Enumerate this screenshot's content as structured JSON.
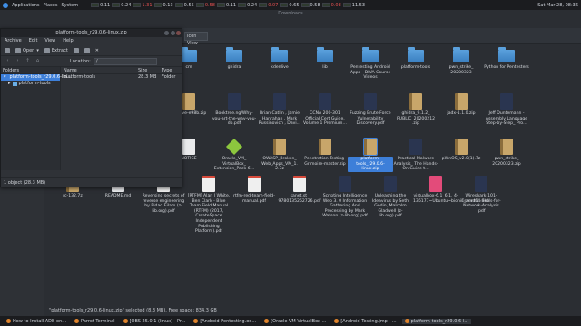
{
  "topbar": {
    "menus": [
      "Applications",
      "Places",
      "System"
    ],
    "clock": "Sat Mar 28, 08:36",
    "cells": [
      "0.11",
      "0.24",
      "1.31",
      "0.13",
      "0.55",
      "0.58",
      "0.11",
      "0.24",
      "0.07",
      "0.65",
      "0.58",
      "0.08",
      "11.53"
    ]
  },
  "file_manager": {
    "title": "Downloads",
    "view_select": "Icon View",
    "status": "\"platform-tools_r29.0.6-linux.zip\" selected (8.3 MB), Free space: 834.3 GB",
    "items": [
      {
        "label": "cm",
        "kind": "folder"
      },
      {
        "label": "ghidra",
        "kind": "folder"
      },
      {
        "label": "kdenlive",
        "kind": "folder"
      },
      {
        "label": "lib",
        "kind": "folder"
      },
      {
        "label": "Pentesting Android Apps - DIVA Course Videos",
        "kind": "folder"
      },
      {
        "label": "platform-tools",
        "kind": "folder"
      },
      {
        "label": "pwn_strike_ 20200323",
        "kind": "folder"
      },
      {
        "label": "Python for Pentesters",
        "kind": "folder"
      },
      {
        "label": "Archive-e98b.zip",
        "kind": "zip"
      },
      {
        "label": "Booktree.ng/Why-you-art-the-way-you-do.pdf",
        "kind": "cover"
      },
      {
        "label": "Brian Catlin , Jamie Hanrahan , Mark Russinovich , Davi…",
        "kind": "cover"
      },
      {
        "label": "CCNA 200-301 Official Cert Guide, Volume 1 Premium…",
        "kind": "cover"
      },
      {
        "label": "Fuzzing Brute Force Vulnerability Discovery.pdf",
        "kind": "cover"
      },
      {
        "label": "ghidra_9.1.2_ PUBLIC_20200212 .zip",
        "kind": "zip"
      },
      {
        "label": "jadx-1.1.0.zip",
        "kind": "zip"
      },
      {
        "label": "Jeff Duntemann - Assembly Language Step-by-Step_ Pro…",
        "kind": "cover"
      },
      {
        "label": "NOTICE",
        "kind": "doc"
      },
      {
        "label": "Oracle_VM_ VirtualBox_ Extension_Pack-6…",
        "kind": "box"
      },
      {
        "label": "OWASP_Broken_ Web_Apps_VM_1. 2.7z",
        "kind": "zip"
      },
      {
        "label": "Penetration-Testing-Grimoire-master.zip",
        "kind": "zip"
      },
      {
        "label": "platform-tools_r29.0.6-linux.zip",
        "kind": "zip",
        "selected": true
      },
      {
        "label": "Practical Malware Analysis_ The Hands-On Guide t…",
        "kind": "cover"
      },
      {
        "label": "pWnOS_v2.0(1).7z",
        "kind": "zip"
      },
      {
        "label": "pwn_strike_ 20200323.zip",
        "kind": "zip"
      },
      {
        "label": "rc-132.7z",
        "kind": "zip"
      },
      {
        "label": "README.md",
        "kind": "doc"
      },
      {
        "label": "Reversing secrets of reverse engineering by Eldad Eilam (z-lib.org).pdf",
        "kind": "pdf"
      },
      {
        "label": "[RTFM] Alan J White, Ben Clark - Blue Team Field Manual (RTFM) (2017, CreateSpace Independent Publishing Platform).pdf",
        "kind": "pdf"
      },
      {
        "label": "rtfm-red-team-field-manual.pdf",
        "kind": "pdf"
      },
      {
        "label": "sanet.st_ 9780135262726.pdf",
        "kind": "pdf"
      },
      {
        "label": "Scripting Intelligence Web 3. 0 Information Gathering And Processing by Mark Watson (z-lib.org).pdf",
        "kind": "cover"
      },
      {
        "label": "Unleashing the Ideavirus by Seth Godin, Malcolm Gladwell (z-lib.org).pdf",
        "kind": "cover"
      },
      {
        "label": "virtualbox-6.1_6.1. 4-136177~Ubuntu~bionic_amd64.deb",
        "kind": "deb"
      },
      {
        "label": "Wireshark-101-Essential-Skills-for-Network-Analysis .pdf",
        "kind": "cover"
      }
    ]
  },
  "archive_manager": {
    "title": "platform-tools_r29.0.6-linux.zip",
    "menu": [
      "Archive",
      "Edit",
      "View",
      "Help"
    ],
    "tools": {
      "open": "Open",
      "extract": "Extract"
    },
    "location_label": "Location:",
    "location_value": "/",
    "side_header": "Folders",
    "tree": [
      "platform-tools_r29.0.6-lin…",
      "platform-tools"
    ],
    "columns": [
      "Name",
      "Size",
      "Type"
    ],
    "rows": [
      {
        "name": "platform-tools",
        "size": "28.3 MB",
        "type": "Folder"
      }
    ],
    "status": "1 object (28.3 MB)"
  },
  "taskbar": {
    "tasks": [
      "How to Install ADB on...",
      "Parrot Terminal",
      "[OBS 25.0.1 (linux) - Pr...",
      "[Android Pentesting.od...",
      "[Oracle VM VirtualBox ...",
      "[Android Testing.jmp - ...",
      "platform-tools_r29.0.6-l..."
    ]
  }
}
